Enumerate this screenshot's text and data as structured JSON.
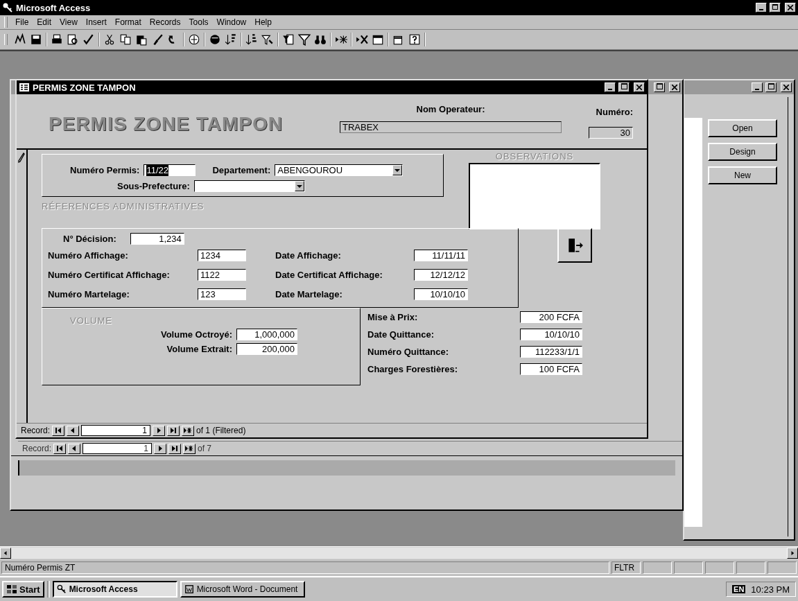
{
  "app_window": {
    "title": "Microsoft Access"
  },
  "menu": [
    {
      "label": "File"
    },
    {
      "label": "Edit"
    },
    {
      "label": "View"
    },
    {
      "label": "Insert"
    },
    {
      "label": "Format"
    },
    {
      "label": "Records"
    },
    {
      "label": "Tools"
    },
    {
      "label": "Window"
    },
    {
      "label": "Help"
    }
  ],
  "database_window": {
    "buttons": [
      "Open",
      "Design",
      "New"
    ]
  },
  "background_form": {
    "record_nav": {
      "label": "Record:",
      "current": "1",
      "total": "of 7"
    }
  },
  "form": {
    "title": "PERMIS ZONE TAMPON",
    "heading": "PERMIS ZONE TAMPON",
    "operator": {
      "label": "Nom Operateur:",
      "value": "TRABEX"
    },
    "numero": {
      "label": "Numéro:",
      "value": "30"
    },
    "numero_permis": {
      "label": "Numéro Permis:",
      "value": "11/22",
      "text_selected": true
    },
    "departement": {
      "label": "Departement:",
      "value": "ABENGOUROU"
    },
    "sous_prefecture": {
      "label": "Sous-Prefecture:"
    },
    "observations": {
      "label": "OBSERVATIONS"
    },
    "references": {
      "title": "RÉFERENCES ADMINISTRATIVES",
      "decision": {
        "label": "N° Décision:",
        "value": "1,234"
      },
      "rows": [
        {
          "label": "Numéro Affichage:",
          "value": "1234",
          "date_label": "Date Affichage:",
          "date_value": "11/11/11"
        },
        {
          "label": "Numéro Certificat Affichage:",
          "value": "1122",
          "date_label": "Date Certificat Affichage:",
          "date_value": "12/12/12"
        },
        {
          "label": "Numéro Martelage:",
          "value": "123",
          "date_label": "Date Martelage:",
          "date_value": "10/10/10"
        }
      ]
    },
    "volume": {
      "title": "VOLUME",
      "fields": [
        {
          "label": "Volume Octroyé:",
          "value": "1,000,000"
        },
        {
          "label": "Volume Extrait:",
          "value": "200,000"
        }
      ]
    },
    "payment": [
      {
        "label": "Mise à Prix:",
        "value": "200 FCFA"
      },
      {
        "label": "Date Quittance:",
        "value": "10/10/10"
      },
      {
        "label": "Numéro Quittance:",
        "value": "112233/1/1"
      },
      {
        "label": "Charges Forestières:",
        "value": "100 FCFA"
      }
    ],
    "record_nav": {
      "label": "Record:",
      "current": "1",
      "total": "of 1 (Filtered)"
    }
  },
  "status_bar": {
    "message": "Numéro Permis ZT",
    "indicators": [
      "FLTR"
    ]
  },
  "taskbar": {
    "start": "Start",
    "tasks": [
      {
        "label": "Microsoft Access",
        "selected": true
      },
      {
        "label": "Microsoft Word - Document",
        "selected": false
      }
    ],
    "language": "EN",
    "clock": "10:23 PM"
  }
}
